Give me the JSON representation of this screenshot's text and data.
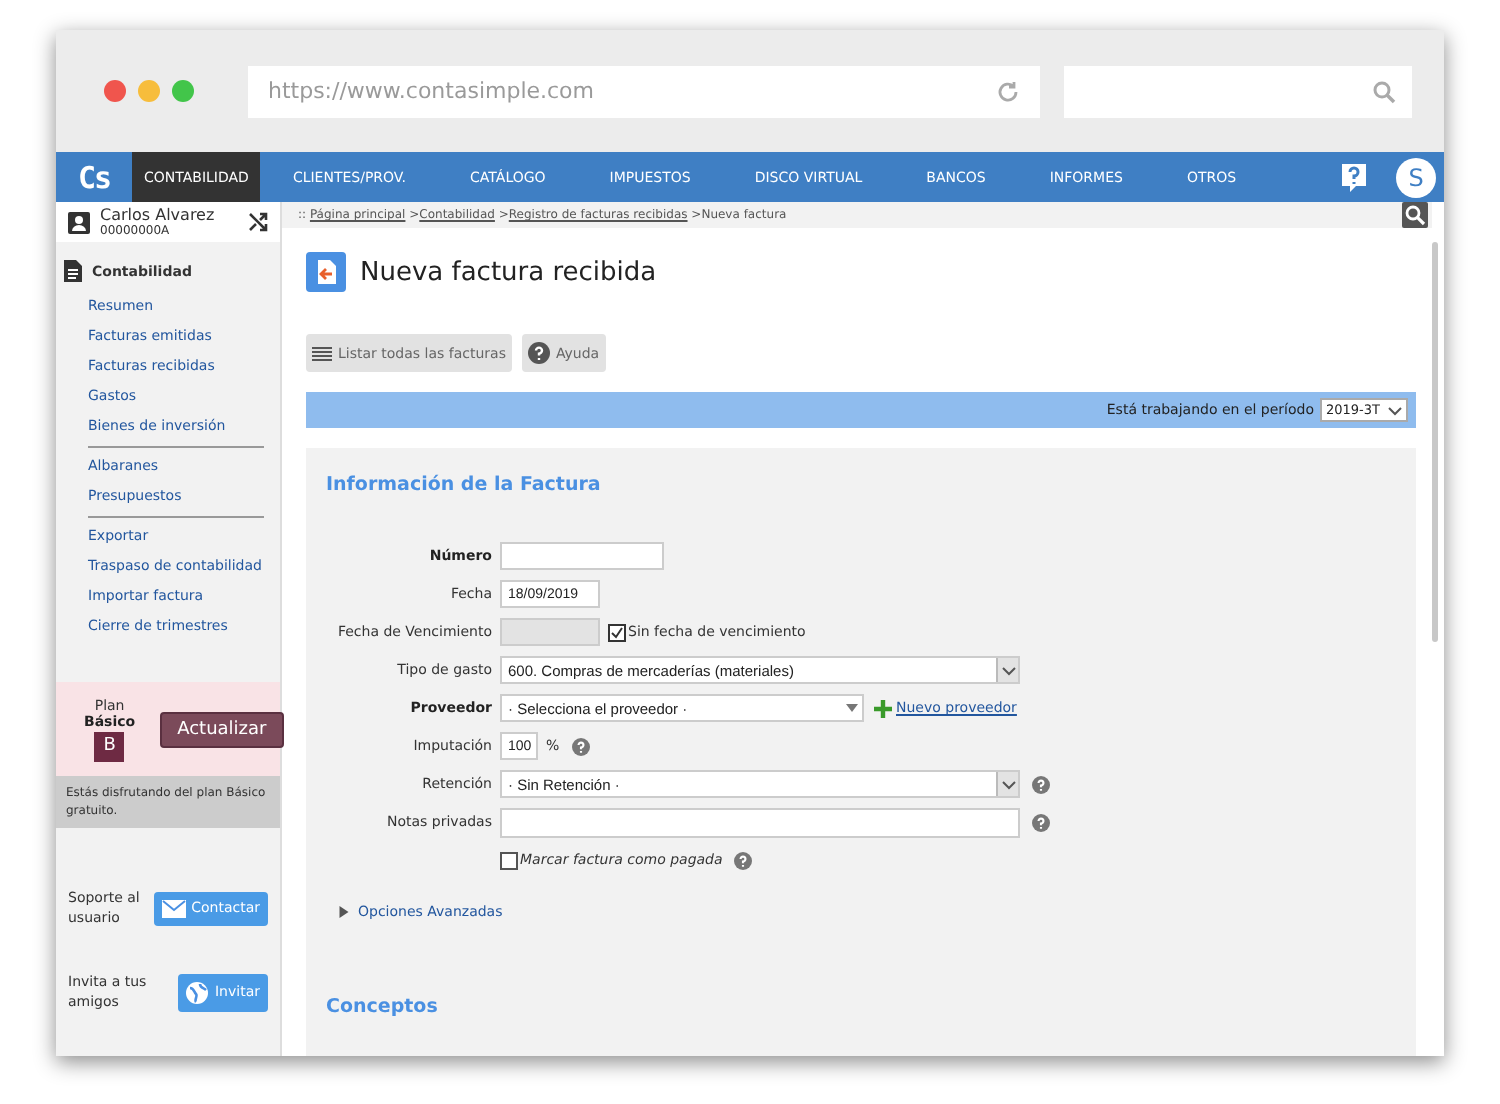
{
  "browser": {
    "url": "https://www.contasimple.com"
  },
  "app": {
    "logo": "Cs",
    "avatar": "S"
  },
  "nav": [
    {
      "label": "CONTABILIDAD",
      "selected": true
    },
    {
      "label": "CLIENTES/PROV.",
      "selected": false
    },
    {
      "label": "CATÁLOGO",
      "selected": false
    },
    {
      "label": "IMPUESTOS",
      "selected": false
    },
    {
      "label": "DISCO VIRTUAL",
      "selected": false
    },
    {
      "label": "BANCOS",
      "selected": false
    },
    {
      "label": "INFORMES",
      "selected": false
    },
    {
      "label": "OTROS",
      "selected": false
    }
  ],
  "user": {
    "name": "Carlos Alvarez",
    "id": "00000000A"
  },
  "breadcrumb": {
    "prefix": "::",
    "links": [
      "Página principal",
      "Contabilidad",
      "Registro de facturas recibidas"
    ],
    "current": "Nueva factura",
    "separator": ">"
  },
  "sidebar": {
    "section": "Contabilidad",
    "groups": [
      [
        "Resumen",
        "Facturas emitidas",
        "Facturas recibidas",
        "Gastos",
        "Bienes de inversión"
      ],
      [
        "Albaranes",
        "Presupuestos"
      ],
      [
        "Exportar",
        "Traspaso de contabilidad",
        "Importar factura",
        "Cierre de trimestres"
      ]
    ],
    "plan": {
      "label": "Plan",
      "name": "Básico",
      "badge": "B",
      "button": "Actualizar",
      "note": "Estás disfrutando del plan Básico gratuito."
    },
    "support": [
      {
        "text": "Soporte al usuario",
        "button": "Contactar",
        "kind": "mail"
      },
      {
        "text": "Invita a tus amigos",
        "button": "Invitar",
        "kind": "globe"
      }
    ]
  },
  "page": {
    "title": "Nueva factura recibida",
    "actions": [
      {
        "label": "Listar todas las facturas",
        "kind": "list"
      },
      {
        "label": "Ayuda",
        "kind": "help"
      }
    ],
    "period_label": "Está trabajando en el período",
    "period": "2019-3T"
  },
  "form": {
    "title": "Información de la Factura",
    "rows": [
      {
        "kind": "text",
        "label": "Número",
        "required": true,
        "value": ""
      },
      {
        "kind": "date",
        "label": "Fecha",
        "required": false,
        "value": "18/09/2019"
      },
      {
        "kind": "disabled",
        "label": "Fecha de Vencimiento",
        "required": false,
        "check_label": "Sin fecha de vencimiento",
        "checked": true
      },
      {
        "kind": "select",
        "label": "Tipo de gasto",
        "required": false,
        "value": "600. Compras de mercaderías (materiales)",
        "help": false
      },
      {
        "kind": "combo",
        "label": "Proveedor",
        "required": true,
        "value": "· Selecciona el proveedor ·",
        "link": "Nuevo proveedor"
      },
      {
        "kind": "percent",
        "label": "Imputación",
        "required": false,
        "value": "100",
        "unit": "%"
      },
      {
        "kind": "select",
        "label": "Retención",
        "required": false,
        "value": "· Sin Retención ·",
        "help": true
      },
      {
        "kind": "textarea",
        "label": "Notas privadas",
        "required": false,
        "value": ""
      },
      {
        "kind": "check",
        "check_label": "Marcar factura como pagada",
        "checked": false
      }
    ],
    "advanced": "Opciones Avanzadas",
    "expanded": false
  },
  "concepts": {
    "title": "Conceptos"
  }
}
